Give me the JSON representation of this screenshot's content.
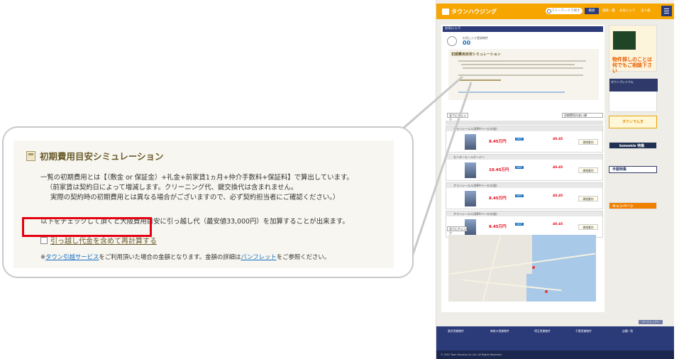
{
  "zoom": {
    "title": "初期費用目安シミュレーション",
    "line1": "一覧の初期費用とは【（敷金 or 保証金）+礼金+前家賃1ヵ月+仲介手数料+保証料】で算出しています。",
    "line2": "（前家賃は契約日によって増減します。クリーニング代、鍵交換代は含まれません。",
    "line3": "実際の契約時の初期費用とは異なる場合がございますので、必ず契約担当者にご確認ください。）",
    "line4": "以下をチェックして頂くと大阪費用目安に引っ越し代（最安値33,000円）を加算することが出来ます。",
    "checkbox_label": "引っ越し代金を含めて再計算する",
    "note_prefix": "※",
    "note_link1": "タウン引越サービス",
    "note_mid": "をご利用頂いた場合の金額となります。金額の詳細は",
    "note_link2": "パンフレット",
    "note_suffix": "をご参照ください。"
  },
  "page": {
    "logo": "タウンハウジング",
    "search_placeholder": "フリーワードで探す",
    "search_button": "検索",
    "header_buttons": [
      "検索一覧",
      "お気に入り",
      "法人様"
    ],
    "favorites_title": "お気に入り",
    "favorites_count_label": "お気に入り登録物件",
    "favorites_count": "00",
    "sim_title": "初期費用目安シミュレーション",
    "check_all": "全てにチェック",
    "sort": "初期費用の安い順",
    "listings": [
      {
        "title": "グランシーエル浅草Aベース口(仮)",
        "price": "8.45万円",
        "rent": "40.45"
      },
      {
        "title": "センターモールガーデン",
        "price": "10.45万円",
        "rent": "40.45"
      },
      {
        "title": "グランシーエル浅草Aベース口(仮)",
        "price": "8.45万円",
        "rent": "40.45"
      },
      {
        "title": "グランシーエル浅草Aベース口(仮)",
        "price": "8.45万円",
        "rent": "40.45"
      }
    ],
    "listing_button": "現地案内",
    "clear_check": "全てにチェック",
    "side_ad1": "物件探しのことは何でもご相談下さい",
    "side_ad2": "タウンプレミアム",
    "side_ad3": "タウンでんき",
    "side_ad4": "konomis 特集",
    "side_ad5": "半額特集",
    "side_ad6": "キャンペーン",
    "to_top": "ページトップへ",
    "footer_nav": [
      "東京賃貸物件",
      "神奈川賃貸物件",
      "埼玉賃貸物件",
      "千葉賃貸物件",
      "店舗一覧"
    ],
    "footer_bottom": "© 2022 Town Housing Co.,Ltd. All Rights Reserved."
  }
}
